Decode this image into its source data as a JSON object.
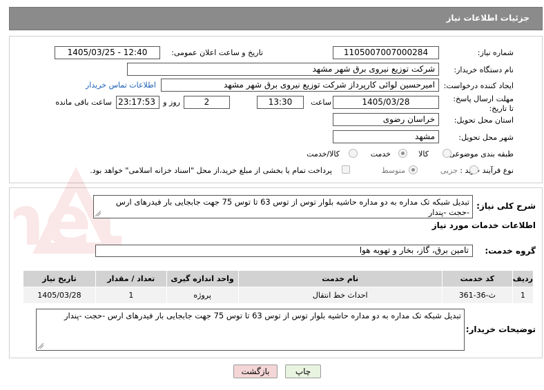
{
  "header": {
    "title": "جزئیات اطلاعات نیاز"
  },
  "form": {
    "need_number_label": "شماره نیاز:",
    "need_number": "1105007007000284",
    "announce_label": "تاریخ و ساعت اعلان عمومی:",
    "announce_value": "1405/03/25 - 12:40",
    "buyer_org_label": "نام دستگاه خریدار:",
    "buyer_org": "شرکت توزیع نیروی برق شهر مشهد",
    "requester_label": "ایجاد کننده درخواست:",
    "requester": "امیرحسین  لوائی کارپرداز شرکت توزیع نیروی برق شهر مشهد",
    "contact_link": "اطلاعات تماس خریدار",
    "deadline_label": "مهلت ارسال پاسخ: تا تاریخ:",
    "deadline_date": "1405/03/28",
    "time_label": "ساعت",
    "deadline_time": "13:30",
    "days_value": "2",
    "days_label": "روز و",
    "remaining_time": "23:17:53",
    "remaining_label": "ساعت باقی مانده",
    "province_label": "استان محل تحویل:",
    "province": "خراسان رضوی",
    "city_label": "شهر محل تحویل:",
    "city": "مشهد",
    "category_label": "طبقه بندی موضوعی:",
    "category_options": [
      "کالا",
      "خدمت",
      "کالا/خدمت"
    ],
    "category_selected": "خدمت",
    "purchase_type_label": "نوع فرآیند خرید :",
    "purchase_options": [
      "جزیی",
      "متوسط"
    ],
    "purchase_selected": "متوسط",
    "payment_note": "پرداخت تمام یا بخشی از مبلغ خرید،از محل \"اسناد خزانه اسلامی\" خواهد بود."
  },
  "details": {
    "summary_label": "شرح کلی نیاز:",
    "summary": "تبدیل شبکه تک مداره به دو مداره حاشیه بلوار توس از توس 63 تا توس 75 جهت جابجایی بار فیدرهای ارس -حجت -پندار",
    "services_heading": "اطلاعات خدمات مورد نیاز",
    "service_group_label": "گروه خدمت:",
    "service_group": "تامین برق، گاز، بخار و تهویه هوا",
    "table": {
      "headers": [
        "ردیف",
        "کد خدمت",
        "نام خدمت",
        "واحد اندازه گیری",
        "تعداد / مقدار",
        "تاریخ نیاز"
      ],
      "rows": [
        [
          "1",
          "ث-36-361",
          "احداث خط انتقال",
          "پروژه",
          "1",
          "1405/03/28"
        ]
      ]
    },
    "buyer_notes_label": "توضیحات خریدار:",
    "buyer_notes": "تبدیل شبکه تک مداره به دو مداره حاشیه بلوار توس از توس 63 تا توس 75 جهت جابجایی بار فیدرهای ارس -حجت -پندار"
  },
  "buttons": {
    "print": "چاپ",
    "back": "بازگشت"
  },
  "watermark": {
    "text": "AriaTender.net"
  },
  "colors": {
    "header": "#8b8b8b",
    "link": "#1a5fb4",
    "table_header": "#d2d2d2"
  }
}
